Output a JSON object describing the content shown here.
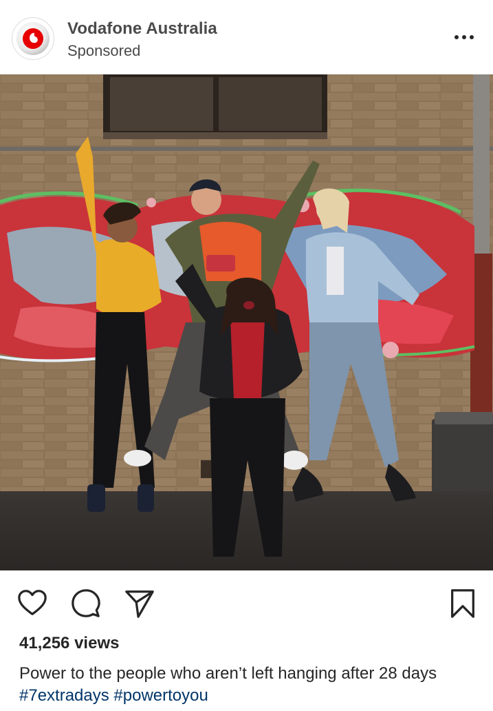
{
  "post": {
    "account_name": "Vodafone Australia",
    "sponsored_label": "Sponsored",
    "more_icon": "more-horizontal-icon",
    "avatar_icon": "vodafone-logo-icon",
    "brand_color": "#e60000"
  },
  "media": {
    "description_icon": "video-photo"
  },
  "actions": {
    "like_icon": "heart-icon",
    "comment_icon": "comment-icon",
    "share_icon": "paper-plane-icon",
    "save_icon": "bookmark-icon"
  },
  "stats": {
    "views": "41,256 views"
  },
  "caption": {
    "text": "Power to the people who aren’t left hanging after 28 days",
    "hashtags": [
      "#7extradays",
      "#powertoyou"
    ],
    "hashtag_color": "#003569"
  }
}
